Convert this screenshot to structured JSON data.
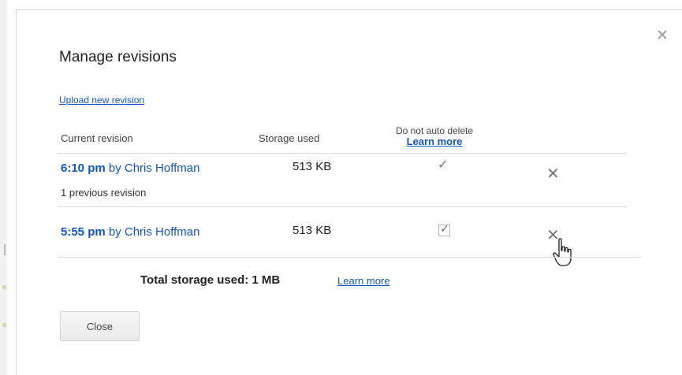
{
  "dialog": {
    "title": "Manage revisions",
    "close_icon": "close-icon",
    "upload_link": "Upload new revision"
  },
  "table": {
    "headers": {
      "current_revision": "Current revision",
      "storage_used": "Storage used",
      "do_not_auto_delete": "Do not auto delete",
      "learn_more": "Learn more"
    },
    "rows": [
      {
        "time": "6:10 pm",
        "by": "by Chris Hoffman",
        "size": "513 KB",
        "keep": "checkmark-icon",
        "note": "1 previous revision"
      },
      {
        "time": "5:55 pm",
        "by": "by Chris Hoffman",
        "size": "513 KB",
        "keep": "checkbox-checked-icon"
      }
    ]
  },
  "footer": {
    "total_label": "Total storage used: 1 MB",
    "learn_more": "Learn more",
    "close_button": "Close"
  },
  "colors": {
    "link": "#1155cc",
    "text": "#222222",
    "divider": "#d9d9d9"
  }
}
